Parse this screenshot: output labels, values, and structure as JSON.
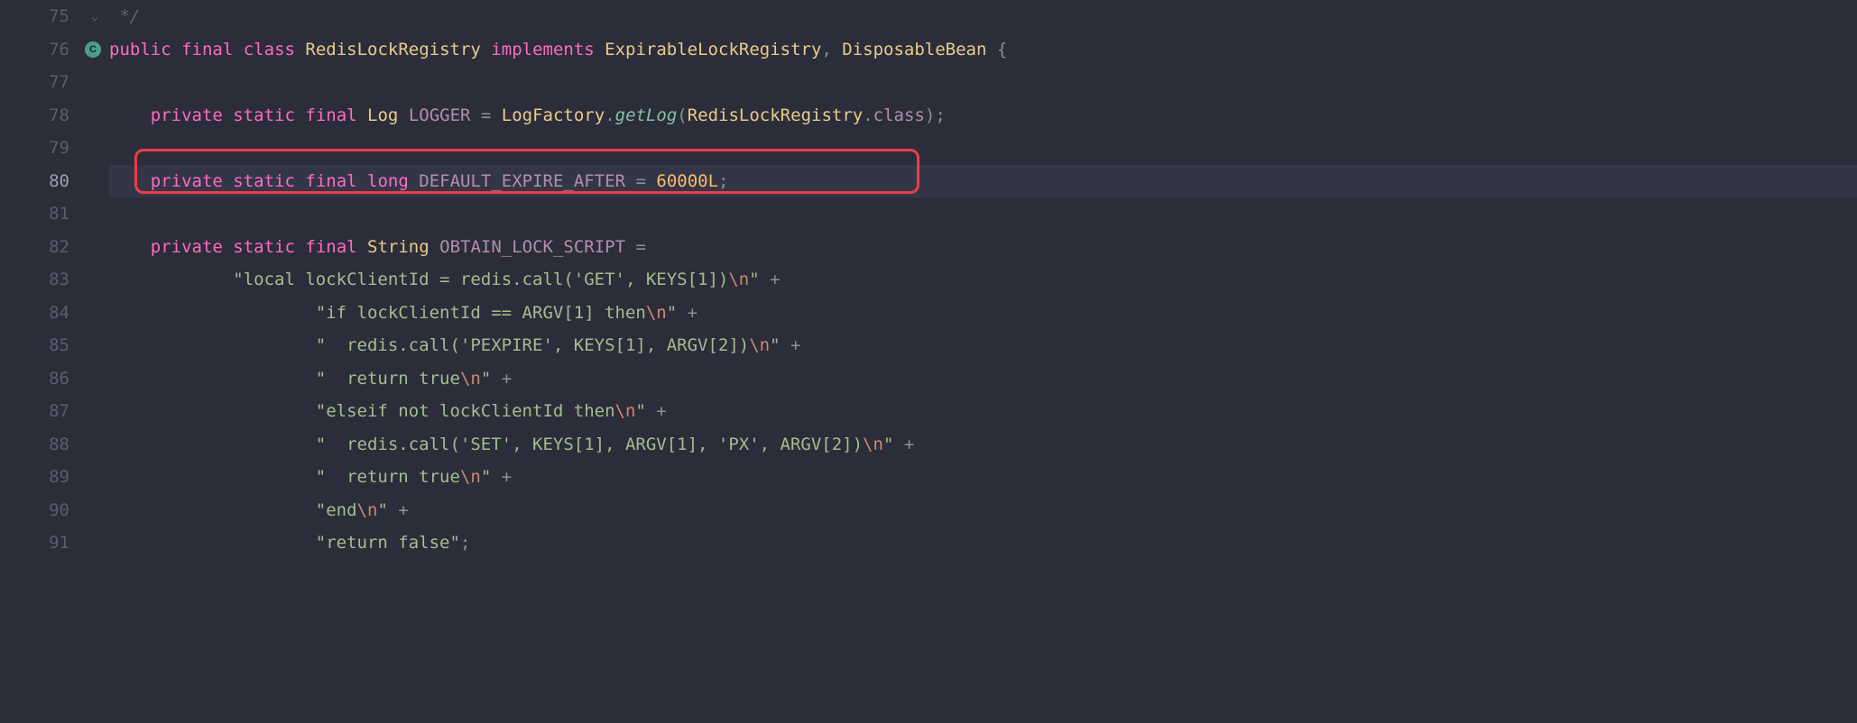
{
  "lines": {
    "n75": "75",
    "n76": "76",
    "n77": "77",
    "n78": "78",
    "n79": "79",
    "n80": "80",
    "n81": "81",
    "n82": "82",
    "n83": "83",
    "n84": "84",
    "n85": "85",
    "n86": "86",
    "n87": "87",
    "n88": "88",
    "n89": "89",
    "n90": "90",
    "n91": "91"
  },
  "tokens": {
    "l75_comment_end": " */",
    "kw_public": "public",
    "kw_final": "final",
    "kw_class": "class",
    "kw_implements": "implements",
    "kw_private": "private",
    "kw_static": "static",
    "kw_long": "long",
    "type_redis": "RedisLockRegistry",
    "type_expirable": "ExpirableLockRegistry",
    "type_disposable": "DisposableBean",
    "type_log": "Log",
    "type_logfactory": "LogFactory",
    "type_string": "String",
    "id_logger": "LOGGER",
    "m_getlog": "getLog",
    "f_class": "class",
    "id_expire": "DEFAULT_EXPIRE_AFTER",
    "v_60000": "60000L",
    "id_obtain": "OBTAIN_LOCK_SCRIPT",
    "s83a": "\"local lockClientId = redis.call('GET', KEYS[1])",
    "esc_n": "\\n",
    "s83b": "\"",
    "s84a": "\"if lockClientId == ARGV[1] then",
    "s85a": "\"  redis.call('PEXPIRE', KEYS[1], ARGV[2])",
    "s86a": "\"  return true",
    "s87a": "\"elseif not lockClientId then",
    "s88a": "\"  redis.call('SET', KEYS[1], ARGV[1], 'PX', ARGV[2])",
    "s89a": "\"  return true",
    "s90a": "\"end",
    "s91a": "\"return false\"",
    "p_eq": " = ",
    "p_comma": ", ",
    "p_brace": " {",
    "p_paren_o": "(",
    "p_paren_c": ")",
    "p_dot": ".",
    "p_semi": ";",
    "p_plus": " +",
    "p_sp": " "
  },
  "icons": {
    "expand": "⌄",
    "class_letter": "C"
  }
}
